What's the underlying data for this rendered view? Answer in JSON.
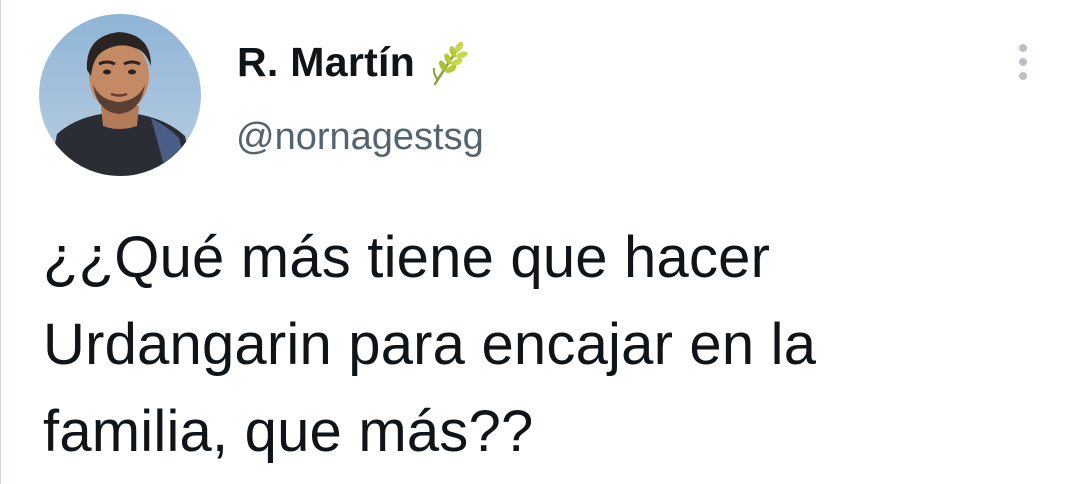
{
  "author": {
    "display_name": "R. Martín",
    "handle": "@nornagestsg",
    "avatar_icon": "profile-photo",
    "badge_icon": "wheat-icon"
  },
  "menu": {
    "icon": "more-options-icon"
  },
  "tweet": {
    "text": "¿¿Qué más tiene que hacer\nUrdangarin para encajar en la\nfamilia, que más??"
  },
  "colors": {
    "text": "#0f1419",
    "secondary": "#536471",
    "menu_dots": "#b9c2c9",
    "wheat": "#b7c93a"
  }
}
